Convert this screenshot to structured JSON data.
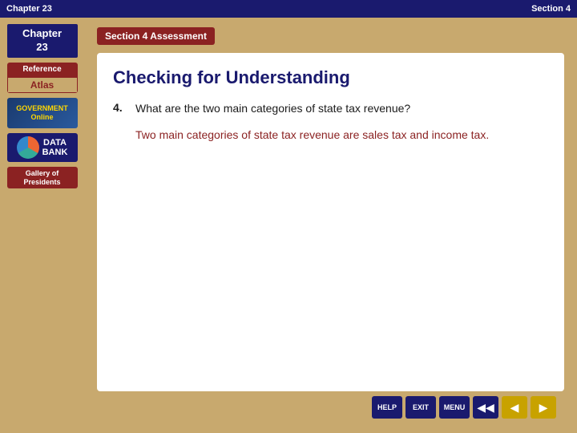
{
  "topbar": {
    "chapter_label": "Chapter",
    "chapter_number": "23",
    "section_label": "Section 4"
  },
  "sidebar": {
    "chapter_box_line1": "Chapter",
    "chapter_box_line2": "23",
    "reference_label": "Reference",
    "atlas_label": "Atlas",
    "government_label": "GOVERNMENT",
    "government_sub": "Online",
    "databank_label": "DATA\nBANK",
    "gallery_label": "Gallery of",
    "presidents_label": "Presidents"
  },
  "content": {
    "section_badge": "Section 4 Assessment",
    "title": "Checking for Understanding",
    "question_number": "4.",
    "question_text": "What are the two main categories of state tax revenue?",
    "answer_text": "Two main categories of state tax revenue are sales tax and income tax."
  },
  "toolbar": {
    "help_label": "HELP",
    "exit_label": "EXIT",
    "menu_label": "MENU",
    "prev_arrow": "◀",
    "back_arrow": "◀",
    "next_arrow": "▶"
  }
}
